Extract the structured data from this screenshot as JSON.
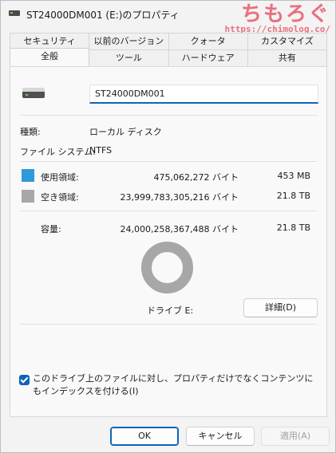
{
  "window": {
    "title": "ST24000DM001 (E:)のプロパティ"
  },
  "watermark": {
    "name": "ちもろぐ",
    "url": "https://chimolog.co/"
  },
  "tabs_back": [
    "セキュリティ",
    "以前のバージョン",
    "クォータ",
    "カスタマイズ"
  ],
  "tabs_front": [
    "全般",
    "ツール",
    "ハードウェア",
    "共有"
  ],
  "active_tab": "全般",
  "drive": {
    "icon": "drive-icon",
    "name_value": "ST24000DM001"
  },
  "info": {
    "type_label": "種類:",
    "type_value": "ローカル ディスク",
    "fs_label": "ファイル システム:",
    "fs_value": "NTFS"
  },
  "usage": {
    "used_label": "使用領域:",
    "used_bytes": "475,062,272 バイト",
    "used_human": "453 MB",
    "free_label": "空き領域:",
    "free_bytes": "23,999,783,305,216 バイト",
    "free_human": "21.8 TB",
    "capacity_label": "容量:",
    "capacity_bytes": "24,000,258,367,488 バイト",
    "capacity_human": "21.8 TB",
    "used_fraction": 1.98e-05,
    "used_color": "#2e9ad7",
    "free_color": "#a7a7a7"
  },
  "drive_letter_label": "ドライブ E:",
  "details_button": "詳細(D)",
  "index_checkbox": {
    "checked": true,
    "label": "このドライブ上のファイルに対し、プロパティだけでなくコンテンツにもインデックスを付ける(I)"
  },
  "buttons": {
    "ok": "OK",
    "cancel": "キャンセル",
    "apply": "適用(A)"
  }
}
